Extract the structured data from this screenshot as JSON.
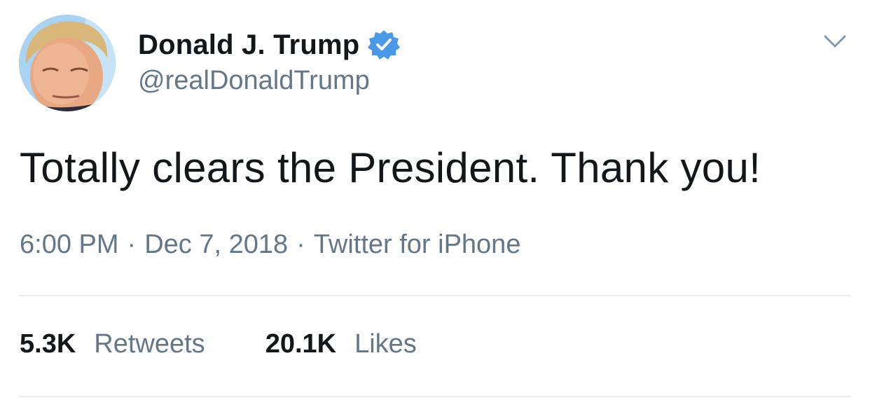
{
  "tweet": {
    "author": {
      "display_name": "Donald J. Trump",
      "handle": "@realDonaldTrump",
      "verified": true,
      "verified_color": "#4a99e9"
    },
    "text": "Totally clears the President. Thank you!",
    "meta": {
      "time": "6:00 PM",
      "separator": "·",
      "date": "Dec 7, 2018",
      "source": "Twitter for iPhone"
    },
    "stats": {
      "retweets": {
        "count": "5.3K",
        "label": "Retweets"
      },
      "likes": {
        "count": "20.1K",
        "label": "Likes"
      }
    },
    "icons": {
      "verified": "verified-badge-icon",
      "menu": "chevron-down-icon"
    },
    "colors": {
      "primary_text": "#14171a",
      "secondary_text": "#657786",
      "divider": "#e6ecf0"
    }
  }
}
